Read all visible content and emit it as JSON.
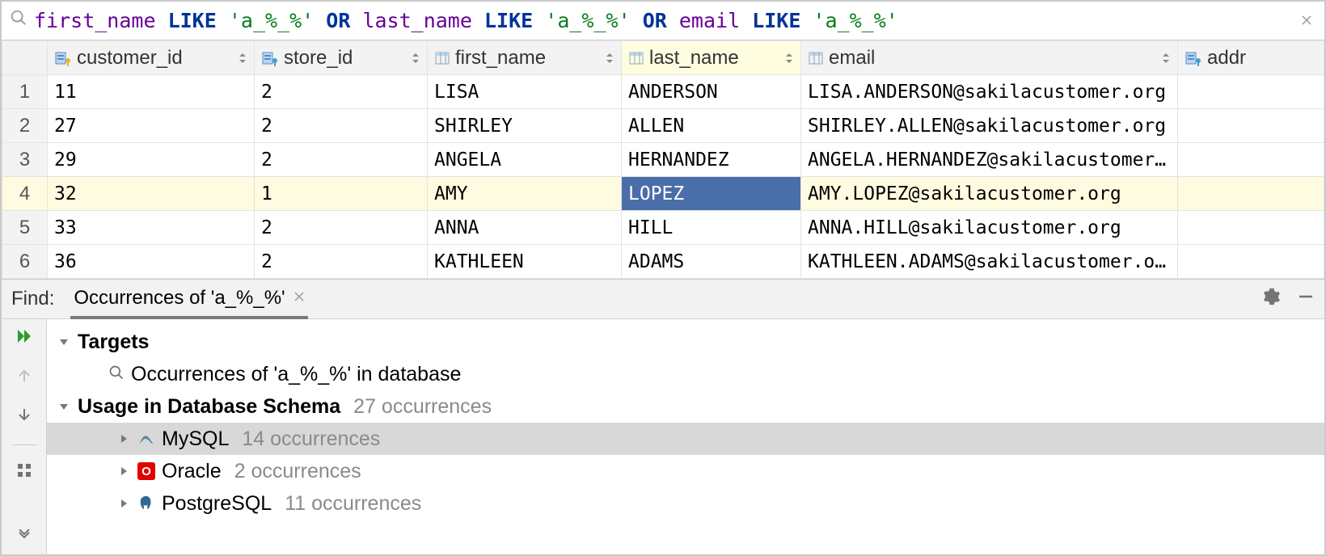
{
  "filter": {
    "col1": "first_name",
    "kw1": "LIKE",
    "str1": "'a_%_%'",
    "or1": "OR",
    "col2": "last_name",
    "kw2": "LIKE",
    "str2": "'a_%_%'",
    "or2": "OR",
    "col3": "email",
    "kw3": "LIKE",
    "str3": "'a_%_%'"
  },
  "columns": {
    "customer_id": "customer_id",
    "store_id": "store_id",
    "first_name": "first_name",
    "last_name": "last_name",
    "email": "email",
    "address": "addr"
  },
  "rows": [
    {
      "n": "1",
      "customer_id": "11",
      "store_id": "2",
      "first_name": "LISA",
      "last_name": "ANDERSON",
      "email": "LISA.ANDERSON@sakilacustomer.org"
    },
    {
      "n": "2",
      "customer_id": "27",
      "store_id": "2",
      "first_name": "SHIRLEY",
      "last_name": "ALLEN",
      "email": "SHIRLEY.ALLEN@sakilacustomer.org"
    },
    {
      "n": "3",
      "customer_id": "29",
      "store_id": "2",
      "first_name": "ANGELA",
      "last_name": "HERNANDEZ",
      "email": "ANGELA.HERNANDEZ@sakilacustomer.…"
    },
    {
      "n": "4",
      "customer_id": "32",
      "store_id": "1",
      "first_name": "AMY",
      "last_name": "LOPEZ",
      "email": "AMY.LOPEZ@sakilacustomer.org"
    },
    {
      "n": "5",
      "customer_id": "33",
      "store_id": "2",
      "first_name": "ANNA",
      "last_name": "HILL",
      "email": "ANNA.HILL@sakilacustomer.org"
    },
    {
      "n": "6",
      "customer_id": "36",
      "store_id": "2",
      "first_name": "KATHLEEN",
      "last_name": "ADAMS",
      "email": "KATHLEEN.ADAMS@sakilacustomer.org"
    }
  ],
  "find": {
    "panel_label": "Find:",
    "tab_label": "Occurrences of 'a_%_%'",
    "targets_label": "Targets",
    "targets_detail": "Occurrences of 'a_%_%' in database",
    "usage_label": "Usage in Database Schema",
    "usage_count": "27 occurrences",
    "dbs": [
      {
        "name": "MySQL",
        "count": "14 occurrences",
        "icon": "mysql"
      },
      {
        "name": "Oracle",
        "count": "2 occurrences",
        "icon": "oracle"
      },
      {
        "name": "PostgreSQL",
        "count": "11 occurrences",
        "icon": "postgres"
      }
    ]
  }
}
